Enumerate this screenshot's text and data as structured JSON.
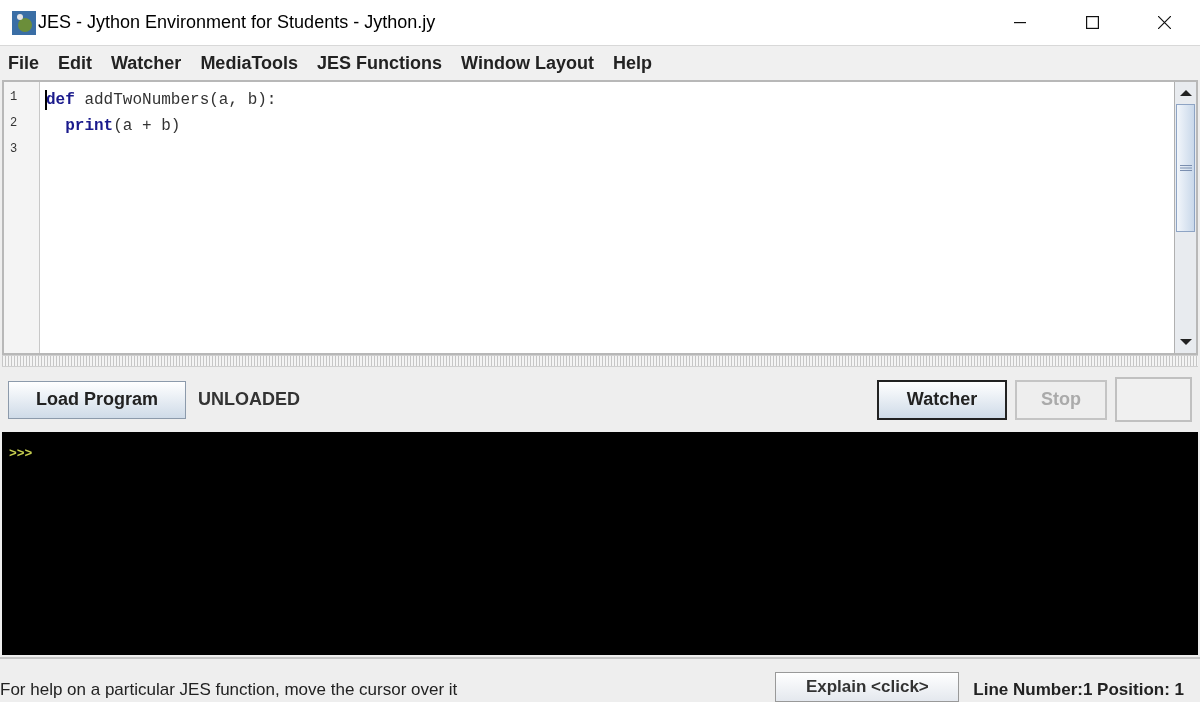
{
  "window": {
    "title": "JES - Jython Environment for Students - Jython.jy"
  },
  "menu": [
    "File",
    "Edit",
    "Watcher",
    "MediaTools",
    "JES Functions",
    "Window Layout",
    "Help"
  ],
  "editor": {
    "lines": [
      {
        "number": "1",
        "tokens": [
          {
            "kind": "keyword",
            "text": "def"
          },
          {
            "kind": "plain",
            "text": " addTwoNumbers(a, b):"
          }
        ]
      },
      {
        "number": "2",
        "tokens": [
          {
            "kind": "keyword",
            "text": "  print"
          },
          {
            "kind": "plain",
            "text": "(a + b)"
          }
        ]
      },
      {
        "number": "3"
      }
    ]
  },
  "toolbar": {
    "load_button": {
      "label": "Load Program",
      "disabled": false
    },
    "load_status": "UNLOADED",
    "buttons": [
      {
        "label": "Watcher",
        "disabled": false
      },
      {
        "label": "Stop",
        "disabled": true
      }
    ]
  },
  "console": {
    "prompt": ">>>"
  },
  "status_bar": {
    "help_text": "For help on a particular JES function, move the cursor over it",
    "explain_button": "Explain <click>",
    "position": "Line Number:1 Position: 1"
  }
}
